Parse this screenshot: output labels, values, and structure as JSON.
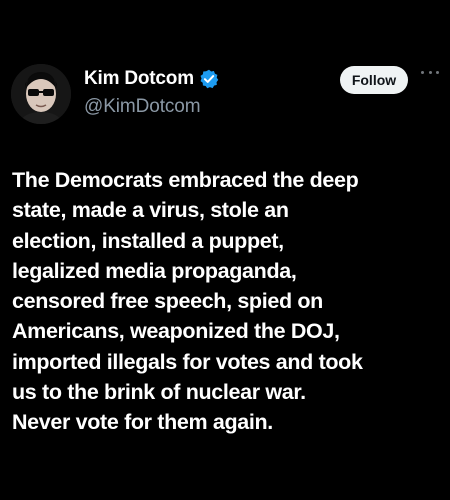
{
  "author": {
    "display_name": "Kim Dotcom",
    "handle": "@KimDotcom",
    "verified": true
  },
  "actions": {
    "follow_label": "Follow",
    "more_icon": "more-horizontal-icon"
  },
  "post": {
    "lines": [
      "The Democrats embraced the deep",
      "state, made a virus, stole an",
      "election, installed a puppet,",
      "legalized media propaganda,",
      "censored free speech, spied on",
      "Americans, weaponized the DOJ,",
      "imported illegals for votes and took",
      "us to the brink of nuclear war.",
      "Never vote for them again."
    ]
  },
  "colors": {
    "background": "#000000",
    "text": "#ffffff",
    "secondary": "#8b98a5",
    "verified_blue": "#1d9bf0",
    "button_bg": "#eff3f4",
    "button_text": "#0f1419"
  }
}
